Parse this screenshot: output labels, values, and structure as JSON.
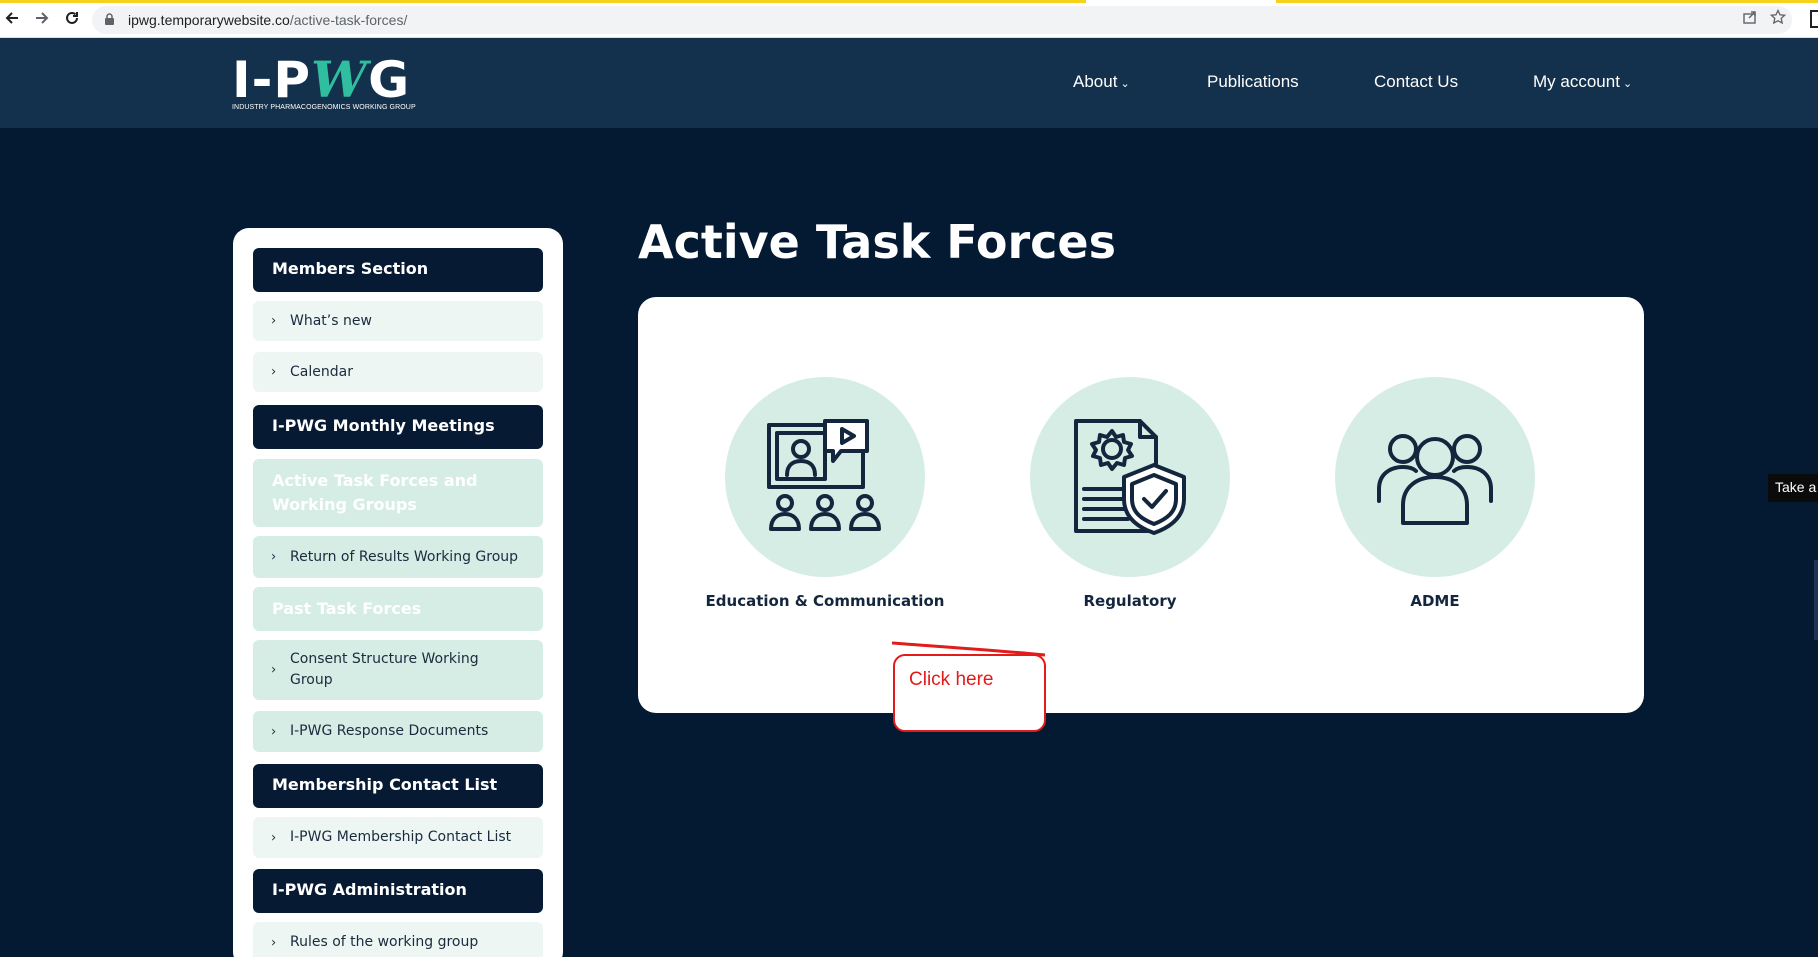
{
  "browser": {
    "url_host": "ipwg.temporarywebsite.co",
    "url_path": "/active-task-forces/",
    "back_icon": "arrow-left-icon",
    "forward_icon": "arrow-right-icon",
    "reload_icon": "reload-icon"
  },
  "header": {
    "logo_text_left": "I-P",
    "logo_text_mid": "W",
    "logo_text_right": "G",
    "logo_subtitle": "INDUSTRY PHARMACOGENOMICS WORKING GROUP",
    "nav": [
      {
        "label": "About",
        "has_caret": true
      },
      {
        "label": "Publications",
        "has_caret": false
      },
      {
        "label": "Contact Us",
        "has_caret": false
      },
      {
        "label": "My account",
        "has_caret": true
      }
    ],
    "caret": "⌄"
  },
  "sidebar": {
    "members_section": "Members Section",
    "whats_new": "What’s new",
    "calendar": "Calendar",
    "monthly_meetings": "I-PWG Monthly Meetings",
    "active_task_forces": "Active Task Forces and Working Groups",
    "return_of_results": "Return of Results Working Group",
    "past_task_forces": "Past Task Forces",
    "consent_structure": "Consent Structure Working Group",
    "response_documents": "I-PWG Response Documents",
    "membership_contact_list_head": "Membership Contact List",
    "membership_contact_list": "I-PWG Membership Contact List",
    "administration": "I-PWG Administration",
    "rules": "Rules of the working group",
    "chevron": "›"
  },
  "main": {
    "title": "Active Task Forces",
    "cards": [
      {
        "label": "Education & Communication",
        "icon": "online-education-icon"
      },
      {
        "label": "Regulatory",
        "icon": "regulatory-document-shield-icon"
      },
      {
        "label": "ADME",
        "icon": "group-people-icon"
      }
    ]
  },
  "annotation": {
    "text": "Click here",
    "color": "#e21b1b"
  },
  "side_tab": {
    "text": "Take a"
  },
  "colors": {
    "page_bg": "#041a33",
    "header_bg": "#13304c",
    "accent_teal": "#2fbfa0",
    "circle_fill": "#d6ede6",
    "sidebar_head": "#071a33"
  }
}
